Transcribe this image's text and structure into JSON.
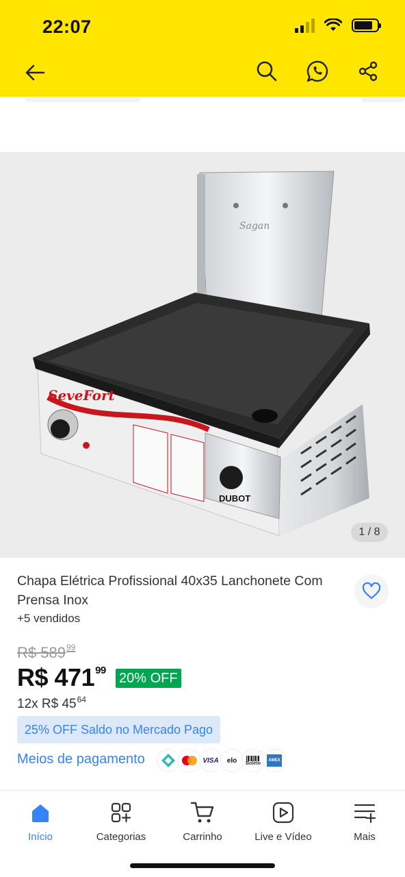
{
  "status_bar": {
    "time": "22:07"
  },
  "header": {
    "icons": [
      "back-arrow-icon",
      "search-icon",
      "whatsapp-icon",
      "share-icon"
    ]
  },
  "gallery": {
    "counter": "1 / 8",
    "brand_print": "SeveFort",
    "brand_print2": "DUBOT"
  },
  "product": {
    "title": "Chapa Elétrica Profissional 40x35 Lanchonete Com Prensa Inox",
    "sold": "+5 vendidos",
    "old_price": {
      "main": "R$ 589",
      "cents": "99"
    },
    "price": {
      "main": "R$ 471",
      "cents": "99"
    },
    "discount": "20% OFF",
    "installments": {
      "main": "12x R$ 45",
      "cents": "64"
    },
    "promo": "25% OFF Saldo no Mercado Pago",
    "payment_link": "Meios de pagamento",
    "payment_methods": [
      "pix-icon",
      "mastercard-icon",
      "VISA",
      "elo",
      "Boleto",
      "AMEX"
    ]
  },
  "bottom_nav": [
    {
      "label": "Início",
      "icon": "home-icon",
      "active": true
    },
    {
      "label": "Categorias",
      "icon": "categories-icon",
      "active": false
    },
    {
      "label": "Carrinho",
      "icon": "cart-icon",
      "active": false
    },
    {
      "label": "Live e Vídeo",
      "icon": "play-icon",
      "active": false
    },
    {
      "label": "Mais",
      "icon": "menu-icon",
      "active": false
    }
  ],
  "colors": {
    "header": "#ffe600",
    "accent": "#3483fa",
    "discount": "#00a650"
  }
}
